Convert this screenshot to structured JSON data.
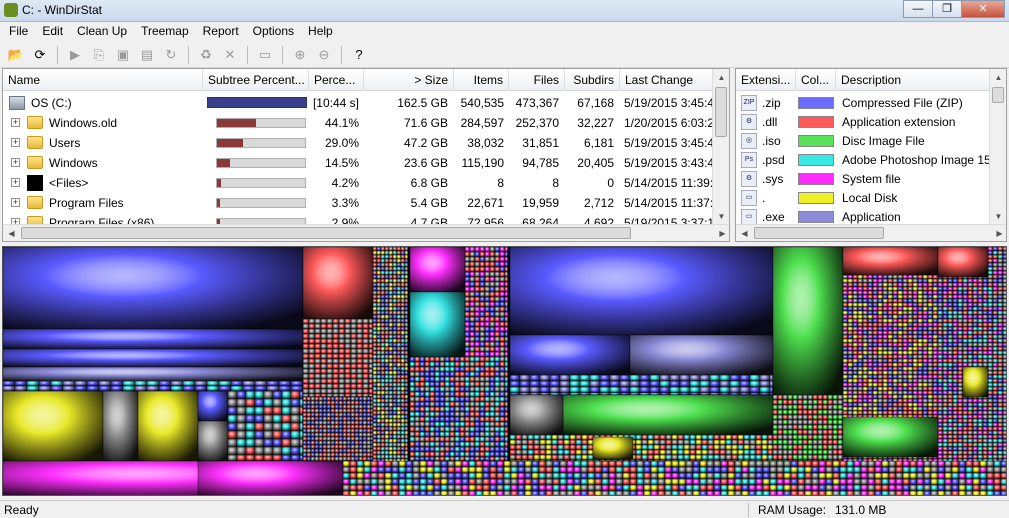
{
  "window": {
    "title": "C: - WinDirStat",
    "buttons": [
      "—",
      "❐",
      "✕"
    ]
  },
  "menu": [
    "File",
    "Edit",
    "Clean Up",
    "Treemap",
    "Report",
    "Options",
    "Help"
  ],
  "toolbar": [
    {
      "icon": "open-folder-icon",
      "glyph": "📂",
      "enabled": true
    },
    {
      "icon": "refresh-icon",
      "glyph": "⟳",
      "enabled": true
    },
    {
      "sep": true
    },
    {
      "icon": "play-icon",
      "glyph": "▶",
      "enabled": false
    },
    {
      "icon": "copy-icon",
      "glyph": "⎘",
      "enabled": false
    },
    {
      "icon": "explorer-icon",
      "glyph": "▣",
      "enabled": false
    },
    {
      "icon": "cmd-icon",
      "glyph": "▤",
      "enabled": false
    },
    {
      "icon": "refresh-selected-icon",
      "glyph": "↻",
      "enabled": false
    },
    {
      "sep": true
    },
    {
      "icon": "recycle-icon",
      "glyph": "♻",
      "enabled": false
    },
    {
      "icon": "delete-icon",
      "glyph": "✕",
      "enabled": false
    },
    {
      "sep": true
    },
    {
      "icon": "new-folder-icon",
      "glyph": "▭",
      "enabled": false
    },
    {
      "sep": true
    },
    {
      "icon": "zoom-in-icon",
      "glyph": "⊕",
      "enabled": false
    },
    {
      "icon": "zoom-out-icon",
      "glyph": "⊖",
      "enabled": false
    },
    {
      "sep": true
    },
    {
      "icon": "help-icon",
      "glyph": "?",
      "enabled": true
    }
  ],
  "dir": {
    "columns": [
      "Name",
      "Subtree Percent...",
      "Perce...",
      "> Size",
      "Items",
      "Files",
      "Subdirs",
      "Last Change"
    ],
    "rows": [
      {
        "name": "OS (C:)",
        "icon": "drive",
        "root": true,
        "pct": "[10:44 s]",
        "size": "162.5 GB",
        "items": "540,535",
        "files": "473,367",
        "subdirs": "67,168",
        "last": "5/19/2015  3:45:4"
      },
      {
        "name": "Windows.old",
        "icon": "folder",
        "fill": 0.441,
        "pct": "44.1%",
        "size": "71.6 GB",
        "items": "284,597",
        "files": "252,370",
        "subdirs": "32,227",
        "last": "1/20/2015  6:03:2"
      },
      {
        "name": "Users",
        "icon": "folder",
        "fill": 0.29,
        "pct": "29.0%",
        "size": "47.2 GB",
        "items": "38,032",
        "files": "31,851",
        "subdirs": "6,181",
        "last": "5/19/2015  3:45:4"
      },
      {
        "name": "Windows",
        "icon": "folder",
        "fill": 0.145,
        "pct": "14.5%",
        "size": "23.6 GB",
        "items": "115,190",
        "files": "94,785",
        "subdirs": "20,405",
        "last": "5/19/2015  3:43:4"
      },
      {
        "name": "<Files>",
        "icon": "files",
        "fill": 0.042,
        "pct": "4.2%",
        "size": "6.8 GB",
        "items": "8",
        "files": "8",
        "subdirs": "0",
        "last": "5/14/2015  11:39:"
      },
      {
        "name": "Program Files",
        "icon": "folder",
        "fill": 0.033,
        "pct": "3.3%",
        "size": "5.4 GB",
        "items": "22,671",
        "files": "19,959",
        "subdirs": "2,712",
        "last": "5/14/2015  11:37:"
      },
      {
        "name": "Program Files (x86)",
        "icon": "folder",
        "fill": 0.029,
        "pct": "2.9%",
        "size": "4.7 GB",
        "items": "72,956",
        "files": "68,264",
        "subdirs": "4,692",
        "last": "5/19/2015  3:37:1"
      }
    ]
  },
  "ext": {
    "columns": [
      "Extensi...",
      "Col...",
      "Description"
    ],
    "rows": [
      {
        "ext": ".zip",
        "color": "#6a6aff",
        "desc": "Compressed File (ZIP)",
        "badge": "ZIP"
      },
      {
        "ext": ".dll",
        "color": "#ff5a5a",
        "desc": "Application extension",
        "badge": "⚙"
      },
      {
        "ext": ".iso",
        "color": "#5ae35a",
        "desc": "Disc Image File",
        "badge": "◎"
      },
      {
        "ext": ".psd",
        "color": "#3ae8e8",
        "desc": "Adobe Photoshop Image 15",
        "badge": "Ps"
      },
      {
        "ext": ".sys",
        "color": "#ff2aff",
        "desc": "System file",
        "badge": "⚙"
      },
      {
        "ext": ".",
        "color": "#f0f02a",
        "desc": "Local Disk",
        "badge": "▭"
      },
      {
        "ext": ".exe",
        "color": "#8a8ad8",
        "desc": "Application",
        "badge": "▭"
      }
    ]
  },
  "treemap": {
    "palette": {
      "blue": "#5a5aff",
      "red": "#ff5a5a",
      "green": "#4ee04e",
      "cyan": "#34e0e0",
      "magenta": "#ff30ff",
      "yellow": "#e8e828",
      "gray": "#9a9a9a",
      "violet": "#8a8ad8"
    }
  },
  "status": {
    "left": "Ready",
    "ram_label": "RAM Usage:",
    "ram_value": "131.0 MB"
  }
}
